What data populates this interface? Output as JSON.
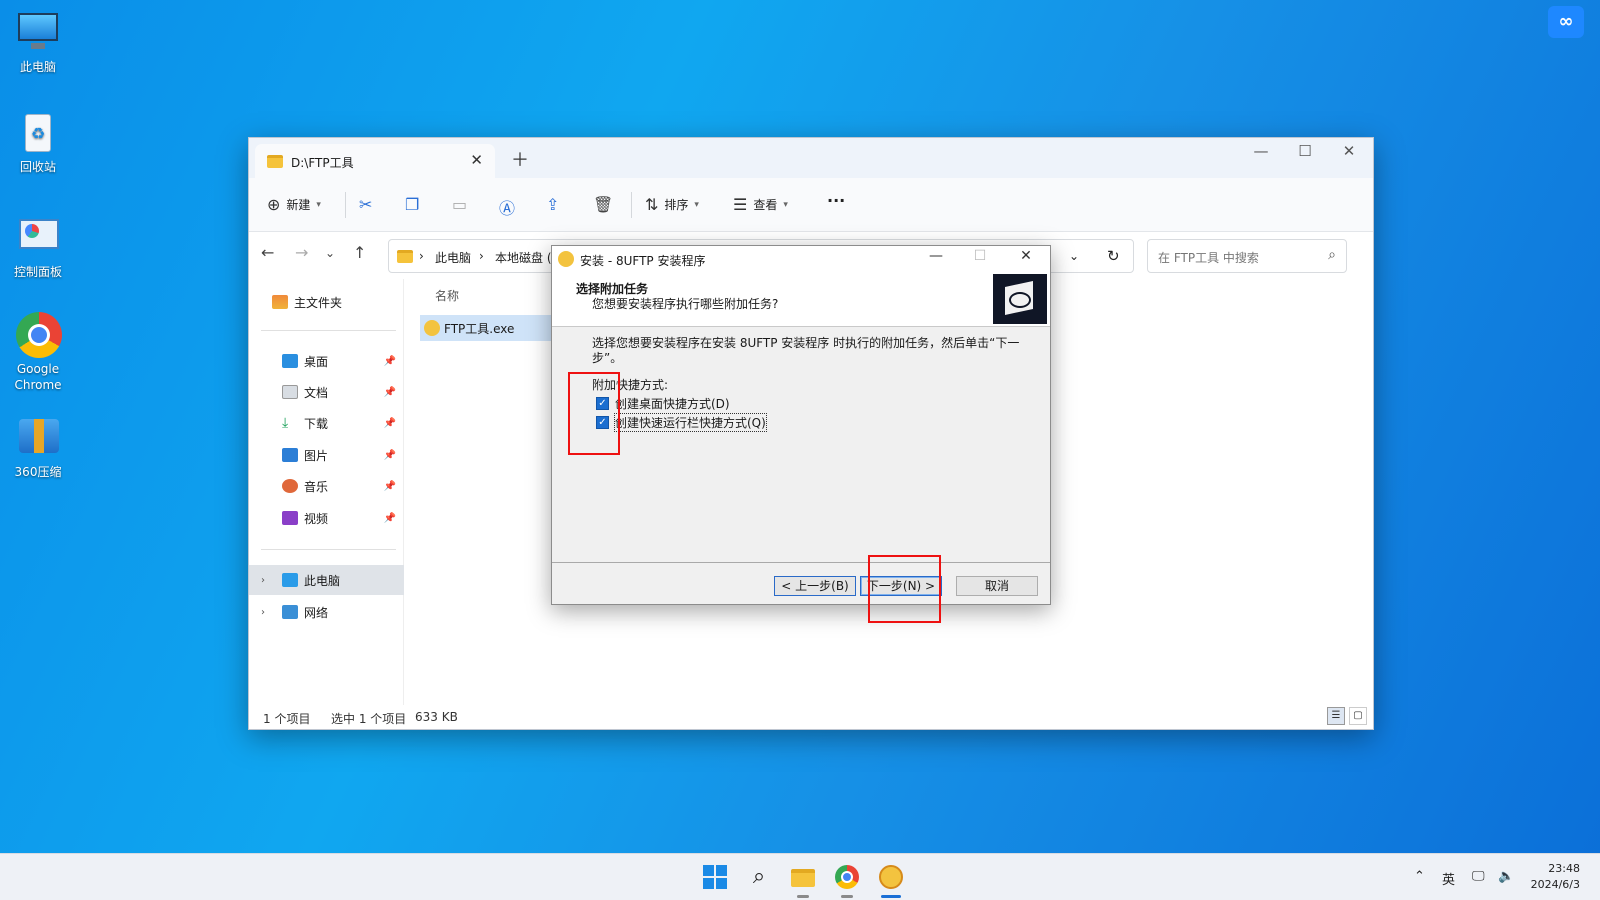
{
  "desktop": {
    "icons": [
      {
        "label": "此电脑"
      },
      {
        "label": "回收站"
      },
      {
        "label": "控制面板"
      },
      {
        "label": "Google Chrome"
      },
      {
        "label": "360压缩"
      }
    ]
  },
  "explorer": {
    "tab_title": "D:\\FTP工具",
    "toolbar": {
      "new_label": "新建",
      "sort_label": "排序",
      "view_label": "查看",
      "more_label": "···"
    },
    "breadcrumb": [
      "此电脑",
      "本地磁盘 ("
    ],
    "search_placeholder": "在 FTP工具 中搜索",
    "sidebar": {
      "home": "主文件夹",
      "pinned": [
        "桌面",
        "文档",
        "下载",
        "图片",
        "音乐",
        "视频"
      ],
      "this_pc": "此电脑",
      "network": "网络"
    },
    "column_name": "名称",
    "file_name": "FTP工具.exe",
    "status": {
      "count": "1 个项目",
      "selected": "选中 1 个项目",
      "size": "633 KB"
    }
  },
  "dialog": {
    "title": "安装 - 8UFTP 安装程序",
    "heading": "选择附加任务",
    "subheading": "您想要安装程序执行哪些附加任务?",
    "intro": "选择您想要安装程序在安装 8UFTP 安装程序 时执行的附加任务，然后单击“下一步”。",
    "group_label": "附加快捷方式:",
    "checkbox_desktop": "创建桌面快捷方式(D)",
    "checkbox_quicklaunch": "创建快速运行栏快捷方式(Q)",
    "btn_back": "< 上一步(B)",
    "btn_next": "下一步(N) >",
    "btn_cancel": "取消"
  },
  "taskbar": {
    "ime": "英",
    "time": "23:48",
    "date": "2024/6/3"
  }
}
